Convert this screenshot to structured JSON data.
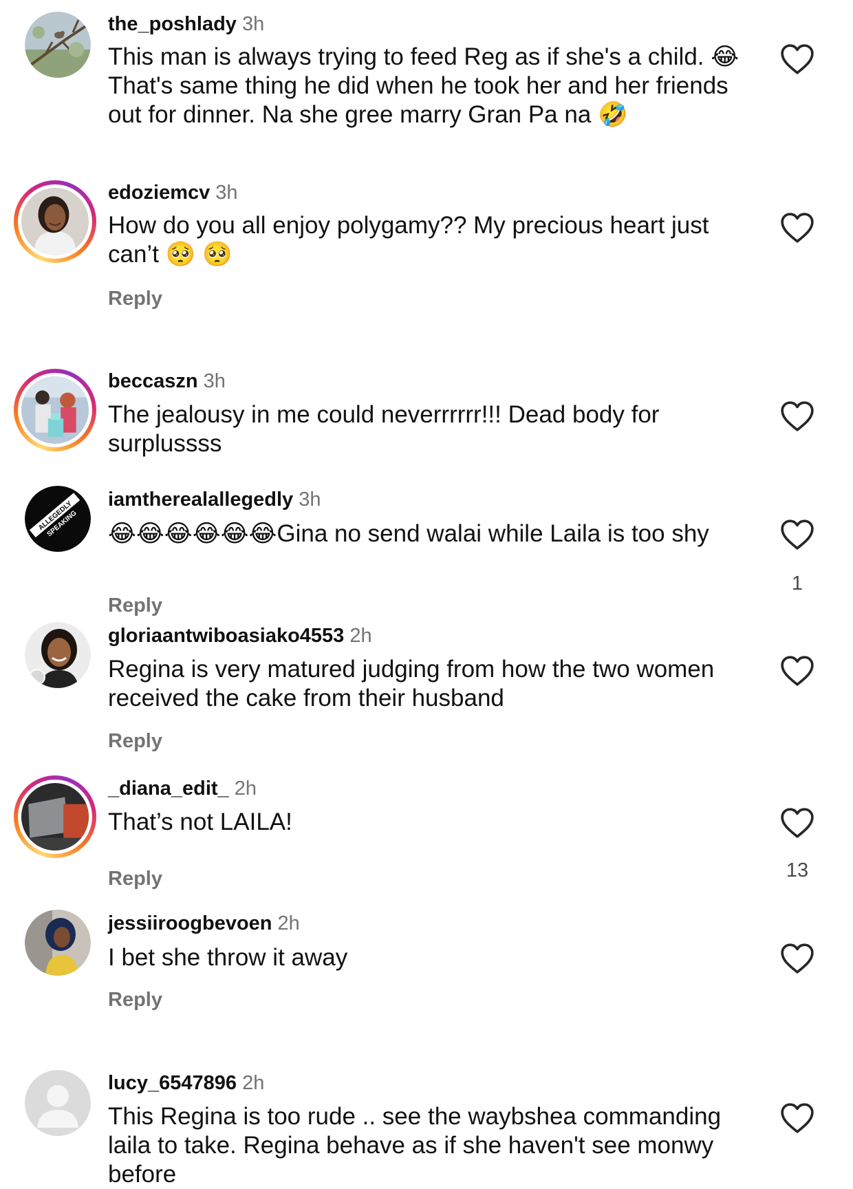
{
  "comments": [
    {
      "username": "the_poshlady",
      "time": "3h",
      "text": "This man is always trying to feed Reg as if she's a child. 😂 That's same thing he did when he took her and her friends out for dinner.  Na she gree marry Gran Pa na 🤣",
      "avatar_icon": "bird-on-branch-avatar"
    },
    {
      "username": "edoziemcv",
      "time": "3h",
      "text": "How do you all enjoy polygamy?? My precious heart just can’t 🥺 🥺",
      "reply": "Reply",
      "avatar_icon": "woman-portrait-avatar"
    },
    {
      "username": "beccaszn",
      "time": "3h",
      "text": "The jealousy in me could neverrrrrr!!! Dead body for surplussss",
      "avatar_icon": "couple-with-cake-avatar"
    },
    {
      "username": "iamtherealallegedly",
      "time": "3h",
      "text": "😂😂😂😂😂😂Gina no send walai while Laila is too shy",
      "reply": "Reply",
      "likes": "1",
      "avatar_logo_text": "ALLEGEDLY SPEAKING"
    },
    {
      "username": "gloriaantwiboasiako4553",
      "time": "2h",
      "text": "Regina is very matured judging from how the two women received the cake from their husband",
      "reply": "Reply",
      "avatar_icon": "smiling-woman-avatar"
    },
    {
      "username": "_diana_edit_",
      "time": "2h",
      "text": "That’s not LAILA!",
      "reply": "Reply",
      "likes": "13",
      "avatar_icon": "laptop-avatar"
    },
    {
      "username": "jessiiroogbevoen",
      "time": "2h",
      "text": "I bet she throw it away",
      "reply": "Reply",
      "avatar_icon": "woman-blue-hair-avatar"
    },
    {
      "username": "lucy_6547896",
      "time": "2h",
      "text": "This Regina is too rude .. see the waybshea commanding laila to take.  Regina behave as if she haven't see  monwy before",
      "avatar_icon": "default-person-avatar"
    }
  ],
  "colors": {
    "text": "#111111",
    "muted": "#737373",
    "heart_stroke": "#262626",
    "ring_gradient": [
      "#feda75",
      "#fa7e1e",
      "#d62976",
      "#962fbf"
    ]
  }
}
